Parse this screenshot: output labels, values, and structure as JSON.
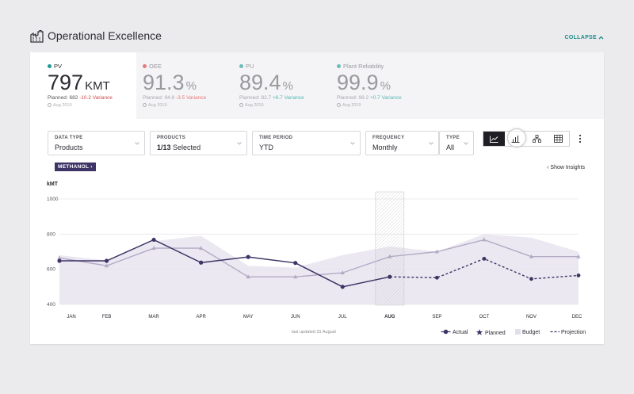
{
  "header": {
    "title": "Operational Excellence",
    "collapse_label": "COLLAPSE"
  },
  "kpis": [
    {
      "label": "PV",
      "value": "797",
      "unit": "KMT",
      "planned": "Planned: 682",
      "variance": "-10.2 Variance",
      "date": "Aug 2019",
      "dot_color": "#1d9a9a",
      "variance_color": "#c94a4a",
      "active": true
    },
    {
      "label": "OEE",
      "value": "91.3",
      "unit": "%",
      "planned": "Planned: 94.8",
      "variance": "-3.5 Variance",
      "date": "Aug 2019",
      "dot_color": "#e47b7b",
      "variance_color": "#e47b7b",
      "active": false
    },
    {
      "label": "PU",
      "value": "89.4",
      "unit": "%",
      "planned": "Planned: 82.7",
      "variance": "+6.7 Variance",
      "date": "Aug 2019",
      "dot_color": "#6cbcbc",
      "variance_color": "#58b6b6",
      "active": false
    },
    {
      "label": "Plant Reliability",
      "value": "99.9",
      "unit": "%",
      "planned": "Planned: 99.2",
      "variance": "+0.7 Variance",
      "date": "Aug 2019",
      "dot_color": "#6cbcbc",
      "variance_color": "#58b6b6",
      "active": false
    }
  ],
  "filters": {
    "data_type": {
      "label": "DATA TYPE",
      "value": "Products"
    },
    "products": {
      "label": "PRODUCTS",
      "value_bold": "1/13",
      "value_rest": "Selected"
    },
    "time_period": {
      "label": "TIME PERIOD",
      "value": "YTD"
    },
    "frequency": {
      "label": "FREQUENCY",
      "value": "Monthly"
    },
    "type": {
      "label": "TYPE",
      "value": "All"
    }
  },
  "view_buttons": [
    "line-chart-icon",
    "bar-chart-icon",
    "hierarchy-icon",
    "table-icon"
  ],
  "chip": "METHANOL",
  "insights_label": "Show Insights",
  "footer": {
    "updated": "last updated 31 August"
  },
  "chart_data": {
    "type": "line",
    "ylabel": "kMT",
    "ylim": [
      400,
      1000
    ],
    "yticks": [
      "1000",
      "800",
      "600",
      "400"
    ],
    "categories": [
      "JAN",
      "FEB",
      "MAR",
      "APR",
      "MAY",
      "JUN",
      "JUL",
      "AUG",
      "SEP",
      "OCT",
      "NOV",
      "DEC"
    ],
    "highlight_category": "AUG",
    "series": [
      {
        "name": "Actual",
        "values": [
          648,
          648,
          768,
          638,
          670,
          636,
          500,
          557,
          null,
          null,
          null,
          null
        ],
        "color": "#3e3466"
      },
      {
        "name": "Planned",
        "values": [
          665,
          620,
          720,
          720,
          557,
          557,
          580,
          672,
          700,
          768,
          672,
          672
        ],
        "color": "#b3abc5"
      },
      {
        "name": "Budget",
        "values": [
          680,
          650,
          760,
          790,
          620,
          610,
          680,
          730,
          700,
          800,
          780,
          700
        ],
        "color": "#e6e2ee"
      },
      {
        "name": "Projection",
        "values": [
          null,
          null,
          null,
          null,
          null,
          null,
          null,
          557,
          552,
          660,
          545,
          565
        ],
        "color": "#3e3466"
      }
    ],
    "legend": [
      "Actual",
      "Planned",
      "Budget",
      "Projection"
    ]
  }
}
